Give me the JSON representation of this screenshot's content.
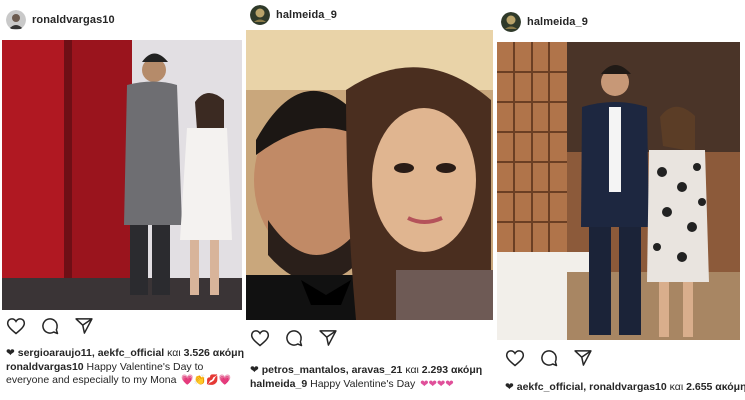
{
  "posts": [
    {
      "username": "ronaldvargas10",
      "likes": {
        "names": "sergioaraujo11, aekfc_official",
        "connector": "και",
        "count": "3.526 ακόμη"
      },
      "caption": {
        "user": "ronaldvargas10",
        "text": "Happy Valentine's Day to everyone and especially to my Mona",
        "emoji": "💗👏💋💗"
      }
    },
    {
      "username": "halmeida_9",
      "likes": {
        "names": "petros_mantalos, aravas_21",
        "connector": "και",
        "count": "2.293 ακόμη"
      },
      "caption": {
        "user": "halmeida_9",
        "text": "Happy Valentine's Day",
        "emoji": "❤❤❤❤"
      }
    },
    {
      "username": "halmeida_9",
      "likes": {
        "names": "aekfc_official, ronaldvargas10",
        "connector": "και",
        "count": "2.655 ακόμη"
      }
    }
  ],
  "icons": {
    "like": "heart-outline-icon",
    "comment": "comment-bubble-icon",
    "share": "send-arrow-icon"
  },
  "colors": {
    "text": "#262626",
    "heart_emoji": "#e0509a",
    "elevator_red": "#b01822"
  }
}
